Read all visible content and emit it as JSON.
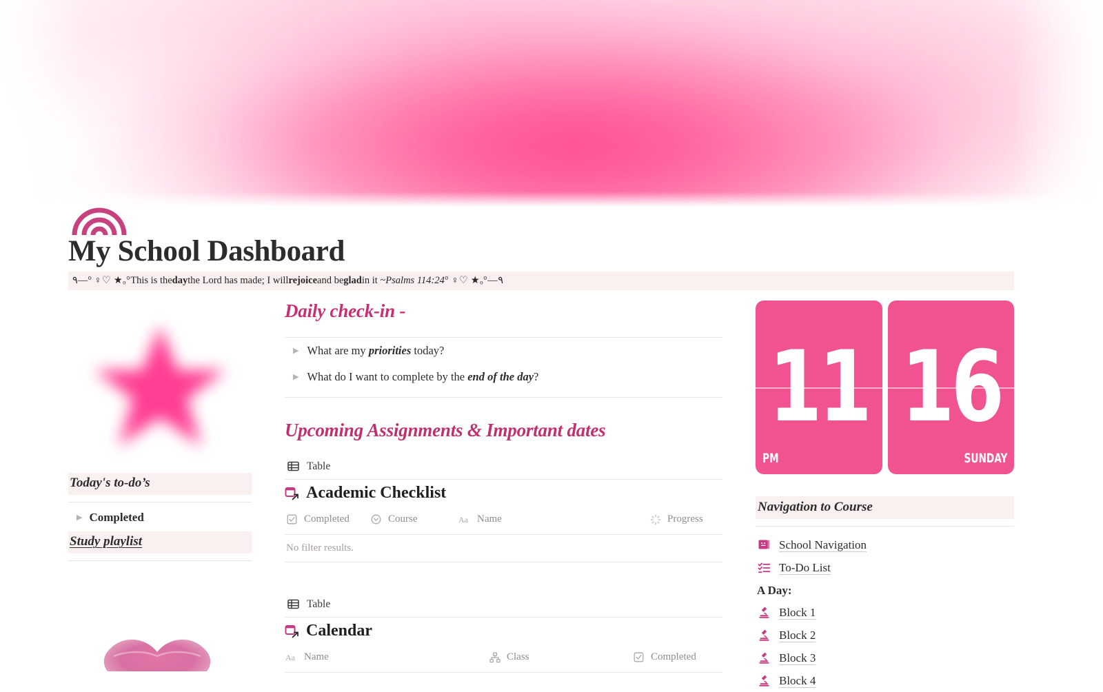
{
  "theme": {
    "accent_pink": "#c72e74",
    "clock_pink": "#f05390",
    "callout_bg": "#fbf0f0",
    "icon_pink": "#c63b82"
  },
  "header": {
    "page_icon": "rainbow-icon",
    "title": "My School Dashboard",
    "quote": {
      "deco_left": "٩—° ♀♡ ★ₒ°",
      "text_1": "This is the ",
      "bold_1": "day",
      "text_2": " the Lord has made; I will ",
      "bold_2": "rejoice",
      "text_3": " and be ",
      "bold_3": "glad",
      "text_4": " in it ~ ",
      "citation": "Psalms 114:24",
      "deco_right": "° ♀♡ ★ₒ°—٩"
    }
  },
  "left_column": {
    "star_image": "blurred-pink-star",
    "todo_heading": "Today's to-do’s",
    "todo_toggle": "Completed",
    "playlist_heading": "Study playlist",
    "lips_image": "glitter-pink-lips"
  },
  "main": {
    "checkin": {
      "title": "Daily check-in -",
      "items": [
        {
          "plain_1": "What are my ",
          "emph": "priorities",
          "plain_2": " today?"
        },
        {
          "plain_1": "What do I want to complete by the ",
          "emph": "end of the day",
          "plain_2": "?"
        }
      ]
    },
    "assignments": {
      "title": "Upcoming Assignments & Important dates",
      "databases": [
        {
          "view_label": "Table",
          "view_icon": "table-icon",
          "db_icon": "calendar-link-icon",
          "db_title": "Academic Checklist",
          "columns": [
            {
              "icon": "checkbox-icon",
              "label": "Completed"
            },
            {
              "icon": "select-icon",
              "label": "Course"
            },
            {
              "icon": "text-aa-icon",
              "label": "Name"
            },
            {
              "icon": "progress-icon",
              "label": "Progress"
            }
          ],
          "empty_text": "No filter results."
        },
        {
          "view_label": "Table",
          "view_icon": "table-icon",
          "db_icon": "calendar-link-icon",
          "db_title": "Calendar",
          "columns": [
            {
              "icon": "text-aa-icon",
              "label": "Name"
            },
            {
              "icon": "relation-icon",
              "label": "Class"
            },
            {
              "icon": "checkbox-icon",
              "label": "Completed"
            }
          ],
          "empty_text": ""
        }
      ]
    }
  },
  "right_column": {
    "clock": {
      "hour": "11",
      "meridiem": "PM",
      "day_number": "16",
      "weekday": "SUNDAY"
    },
    "nav_heading": "Navigation to Course",
    "nav_links": [
      {
        "icon": "book-icon",
        "label": "School Navigation"
      },
      {
        "icon": "checklist-icon",
        "label": "To-Do List"
      }
    ],
    "day_label": "A Day:",
    "blocks": [
      {
        "icon": "microscope-icon",
        "label": "Block 1"
      },
      {
        "icon": "microscope-icon",
        "label": "Block 2"
      },
      {
        "icon": "microscope-icon",
        "label": "Block 3"
      },
      {
        "icon": "microscope-icon",
        "label": "Block 4"
      }
    ]
  }
}
